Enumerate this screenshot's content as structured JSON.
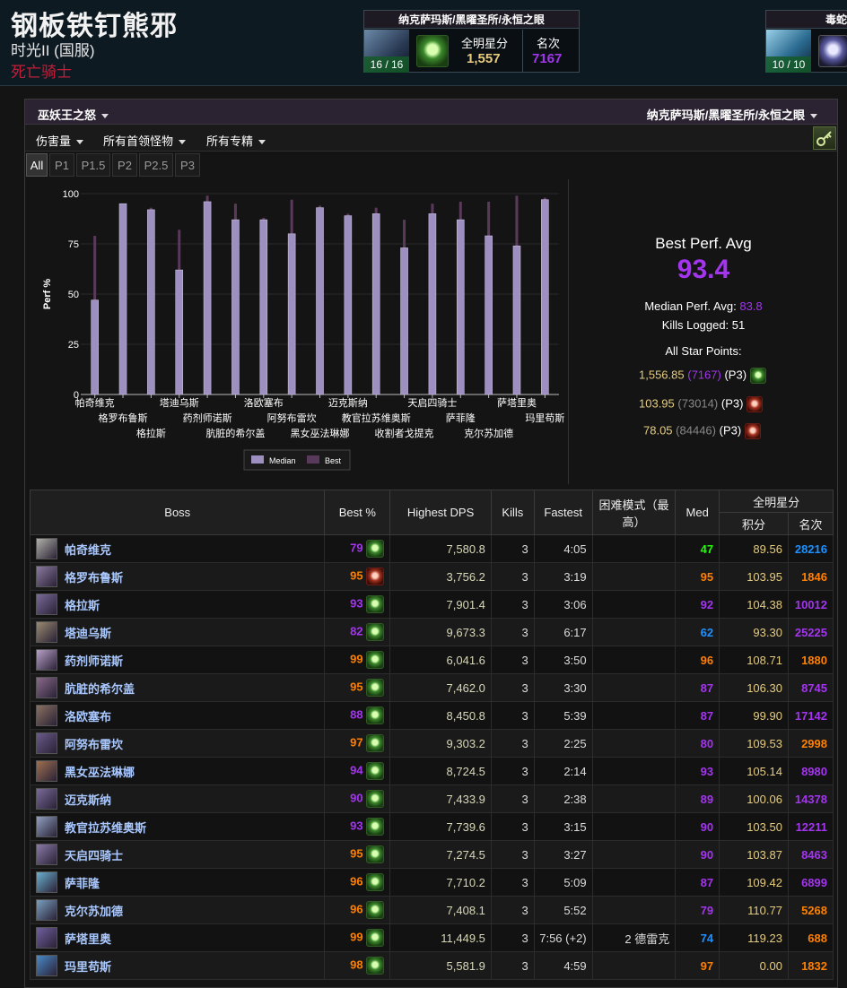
{
  "header": {
    "character_name": "钢板铁钉熊邪",
    "realm": "时光II (国服)",
    "class_name": "死亡骑士",
    "class_color": "#c41e3a"
  },
  "zone_cards": [
    {
      "title": "纳克萨玛斯/黑曜圣所/永恒之眼",
      "progress": "16 / 16",
      "stat1_label": "全明星分",
      "stat1_value": "1,557",
      "stat2_label": "名次",
      "stat2_value": "7167"
    },
    {
      "title": "毒蛇",
      "progress": "10 / 10"
    }
  ],
  "filters": {
    "expansion": "巫妖王之怒",
    "zone": "纳克萨玛斯/黑曜圣所/永恒之眼",
    "metric": "伤害量",
    "encounter": "所有首领怪物",
    "spec": "所有专精"
  },
  "phase_tabs": [
    "All",
    "P1",
    "P1.5",
    "P2",
    "P2.5",
    "P3"
  ],
  "active_tab": "All",
  "chart_data": {
    "type": "bar",
    "ylabel": "Perf %",
    "ylim": [
      0,
      100
    ],
    "yticks": [
      0,
      25,
      50,
      75,
      100
    ],
    "categories": [
      "帕奇维克",
      "格罗布鲁斯",
      "格拉斯",
      "塔迪乌斯",
      "药剂师诺斯",
      "肮脏的希尔盖",
      "洛欧塞布",
      "阿努布雷坎",
      "黑女巫法琳娜",
      "迈克斯纳",
      "教官拉苏维奥斯",
      "收割者戈提克",
      "天启四骑士",
      "萨菲隆",
      "克尔苏加德",
      "萨塔里奥",
      "玛里苟斯"
    ],
    "series": [
      {
        "name": "Median",
        "color": "#9d8fc0",
        "values": [
          47,
          95,
          92,
          62,
          96,
          87,
          87,
          80,
          93,
          89,
          90,
          73,
          90,
          87,
          79,
          74,
          97
        ]
      },
      {
        "name": "Best",
        "color": "#5a3a5a",
        "values": [
          79,
          95,
          93,
          82,
          99,
          95,
          88,
          97,
          94,
          90,
          93,
          87,
          95,
          96,
          96,
          99,
          98
        ]
      }
    ],
    "legend_position": "bottom"
  },
  "summary": {
    "best_perf_label": "Best Perf. Avg",
    "best_perf_value": "93.4",
    "median_label": "Median Perf. Avg:",
    "median_value": "83.8",
    "kills_label": "Kills Logged:",
    "kills_value": "51",
    "allstar_label": "All Star Points:",
    "allstar_rows": [
      {
        "points": "1,556.85",
        "rank": "7167",
        "phase": "(P3)",
        "icon": "green-skull-icon",
        "rank_color": "#a335ee"
      },
      {
        "points": "103.95",
        "rank": "73014",
        "phase": "(P3)",
        "icon": "red-claw-icon",
        "rank_color": "#888888"
      },
      {
        "points": "78.05",
        "rank": "84446",
        "phase": "(P3)",
        "icon": "red-skull-icon",
        "rank_color": "#888888"
      }
    ]
  },
  "table": {
    "headers": {
      "boss": "Boss",
      "best": "Best %",
      "dps": "Highest DPS",
      "kills": "Kills",
      "fastest": "Fastest",
      "hard": "困难模式（最高）",
      "med": "Med",
      "allstar": "全明星分",
      "points": "积分",
      "rank": "名次"
    },
    "rows": [
      {
        "boss": "帕奇维克",
        "best": "79",
        "best_q": "q-epic",
        "dps": "7,580.8",
        "kills": "3",
        "fastest": "4:05",
        "hard": "",
        "med": "47",
        "med_q": "q-unc",
        "points": "89.56",
        "rank": "28216",
        "rank_q": "q-rare",
        "icon": "green-skull-icon"
      },
      {
        "boss": "格罗布鲁斯",
        "best": "95",
        "best_q": "q-leg",
        "dps": "3,756.2",
        "kills": "3",
        "fastest": "3:19",
        "hard": "",
        "med": "95",
        "med_q": "q-leg",
        "points": "103.95",
        "rank": "1846",
        "rank_q": "q-leg",
        "icon": "red-claw-icon"
      },
      {
        "boss": "格拉斯",
        "best": "93",
        "best_q": "q-epic",
        "dps": "7,901.4",
        "kills": "3",
        "fastest": "3:06",
        "hard": "",
        "med": "92",
        "med_q": "q-epic",
        "points": "104.38",
        "rank": "10012",
        "rank_q": "q-epic",
        "icon": "green-skull-icon"
      },
      {
        "boss": "塔迪乌斯",
        "best": "82",
        "best_q": "q-epic",
        "dps": "9,673.3",
        "kills": "3",
        "fastest": "6:17",
        "hard": "",
        "med": "62",
        "med_q": "q-rare",
        "points": "93.30",
        "rank": "25225",
        "rank_q": "q-epic",
        "icon": "green-skull-icon"
      },
      {
        "boss": "药剂师诺斯",
        "best": "99",
        "best_q": "q-leg",
        "dps": "6,041.6",
        "kills": "3",
        "fastest": "3:50",
        "hard": "",
        "med": "96",
        "med_q": "q-leg",
        "points": "108.71",
        "rank": "1880",
        "rank_q": "q-leg",
        "icon": "green-skull-icon"
      },
      {
        "boss": "肮脏的希尔盖",
        "best": "95",
        "best_q": "q-leg",
        "dps": "7,462.0",
        "kills": "3",
        "fastest": "3:30",
        "hard": "",
        "med": "87",
        "med_q": "q-epic",
        "points": "106.30",
        "rank": "8745",
        "rank_q": "q-epic",
        "icon": "green-skull-icon"
      },
      {
        "boss": "洛欧塞布",
        "best": "88",
        "best_q": "q-epic",
        "dps": "8,450.8",
        "kills": "3",
        "fastest": "5:39",
        "hard": "",
        "med": "87",
        "med_q": "q-epic",
        "points": "99.90",
        "rank": "17142",
        "rank_q": "q-epic",
        "icon": "green-skull-icon"
      },
      {
        "boss": "阿努布雷坎",
        "best": "97",
        "best_q": "q-leg",
        "dps": "9,303.2",
        "kills": "3",
        "fastest": "2:25",
        "hard": "",
        "med": "80",
        "med_q": "q-epic",
        "points": "109.53",
        "rank": "2998",
        "rank_q": "q-leg",
        "icon": "green-skull-icon"
      },
      {
        "boss": "黑女巫法琳娜",
        "best": "94",
        "best_q": "q-epic",
        "dps": "8,724.5",
        "kills": "3",
        "fastest": "2:14",
        "hard": "",
        "med": "93",
        "med_q": "q-epic",
        "points": "105.14",
        "rank": "8980",
        "rank_q": "q-epic",
        "icon": "green-skull-icon"
      },
      {
        "boss": "迈克斯纳",
        "best": "90",
        "best_q": "q-epic",
        "dps": "7,433.9",
        "kills": "3",
        "fastest": "2:38",
        "hard": "",
        "med": "89",
        "med_q": "q-epic",
        "points": "100.06",
        "rank": "14378",
        "rank_q": "q-epic",
        "icon": "green-skull-icon"
      },
      {
        "boss": "教官拉苏维奥斯",
        "best": "93",
        "best_q": "q-epic",
        "dps": "7,739.6",
        "kills": "3",
        "fastest": "3:15",
        "hard": "",
        "med": "90",
        "med_q": "q-epic",
        "points": "103.50",
        "rank": "12211",
        "rank_q": "q-epic",
        "icon": "green-skull-icon"
      },
      {
        "boss": "天启四骑士",
        "best": "95",
        "best_q": "q-leg",
        "dps": "7,274.5",
        "kills": "3",
        "fastest": "3:27",
        "hard": "",
        "med": "90",
        "med_q": "q-epic",
        "points": "103.87",
        "rank": "8463",
        "rank_q": "q-epic",
        "icon": "green-skull-icon"
      },
      {
        "boss": "萨菲隆",
        "best": "96",
        "best_q": "q-leg",
        "dps": "7,710.2",
        "kills": "3",
        "fastest": "5:09",
        "hard": "",
        "med": "87",
        "med_q": "q-epic",
        "points": "109.42",
        "rank": "6899",
        "rank_q": "q-epic",
        "icon": "green-skull-icon"
      },
      {
        "boss": "克尔苏加德",
        "best": "96",
        "best_q": "q-leg",
        "dps": "7,408.1",
        "kills": "3",
        "fastest": "5:52",
        "hard": "",
        "med": "79",
        "med_q": "q-epic",
        "points": "110.77",
        "rank": "5268",
        "rank_q": "q-leg",
        "icon": "green-skull-icon"
      },
      {
        "boss": "萨塔里奥",
        "best": "99",
        "best_q": "q-leg",
        "dps": "11,449.5",
        "kills": "3",
        "fastest": "7:56 (+2)",
        "hard": "2 德雷克",
        "med": "74",
        "med_q": "q-rare",
        "points": "119.23",
        "rank": "688",
        "rank_q": "q-leg",
        "icon": "green-skull-icon"
      },
      {
        "boss": "玛里苟斯",
        "best": "98",
        "best_q": "q-leg",
        "dps": "5,581.9",
        "kills": "3",
        "fastest": "4:59",
        "hard": "",
        "med": "97",
        "med_q": "q-leg",
        "points": "0.00",
        "rank": "1832",
        "rank_q": "q-leg",
        "icon": "green-skull-icon"
      }
    ]
  }
}
